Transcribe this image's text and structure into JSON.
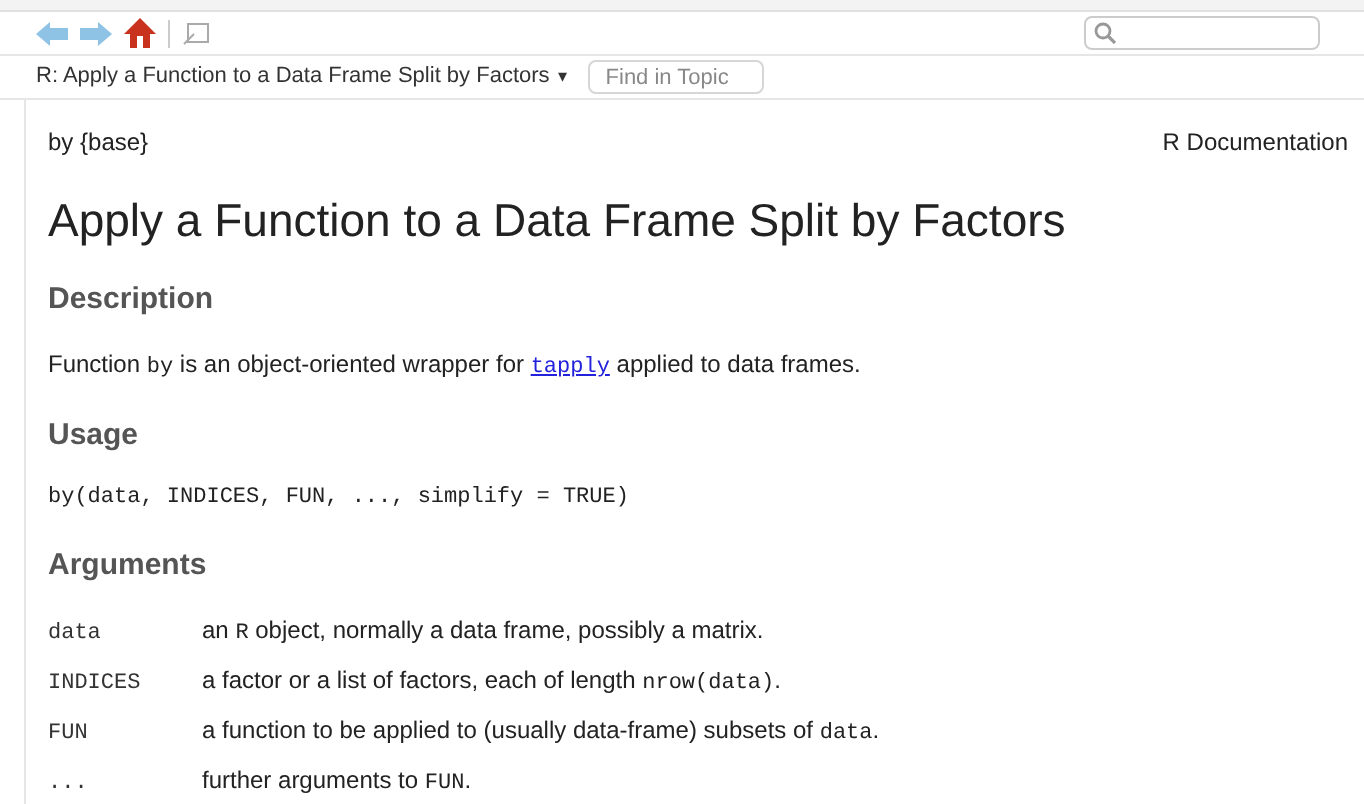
{
  "topic_bar": {
    "topic": "R: Apply a Function to a Data Frame Split by Factors",
    "caret": "▾",
    "find": {
      "placeholder": "Find in Topic"
    }
  },
  "header": {
    "package": "by {base}",
    "source": "R Documentation"
  },
  "title": "Apply a Function to a Data Frame Split by Factors",
  "sections": [
    {
      "heading": "Description",
      "kind": "text",
      "segments": [
        {
          "kind": "text",
          "text": "Function "
        },
        {
          "kind": "code",
          "text": "by"
        },
        {
          "kind": "text",
          "text": " is an object-oriented wrapper for "
        },
        {
          "kind": "link",
          "text": "tapply"
        },
        {
          "kind": "text",
          "text": " applied to data frames."
        }
      ]
    },
    {
      "heading": "Usage",
      "kind": "code",
      "code": "by(data, INDICES, FUN, ..., simplify = TRUE)"
    },
    {
      "heading": "Arguments",
      "kind": "arguments",
      "arguments": [
        {
          "name": "data",
          "segments": [
            {
              "kind": "text",
              "text": "an "
            },
            {
              "kind": "code",
              "text": "R"
            },
            {
              "kind": "text",
              "text": " object, normally a data frame, possibly a matrix."
            }
          ]
        },
        {
          "name": "INDICES",
          "segments": [
            {
              "kind": "text",
              "text": "a factor or a list of factors, each of length "
            },
            {
              "kind": "code",
              "text": "nrow(data)"
            },
            {
              "kind": "text",
              "text": "."
            }
          ]
        },
        {
          "name": "FUN",
          "segments": [
            {
              "kind": "text",
              "text": "a function to be applied to (usually data-frame) subsets of "
            },
            {
              "kind": "code",
              "text": "data"
            },
            {
              "kind": "text",
              "text": "."
            }
          ]
        },
        {
          "name": "...",
          "segments": [
            {
              "kind": "text",
              "text": "further arguments to "
            },
            {
              "kind": "code",
              "text": "FUN"
            },
            {
              "kind": "text",
              "text": "."
            }
          ]
        }
      ]
    }
  ]
}
